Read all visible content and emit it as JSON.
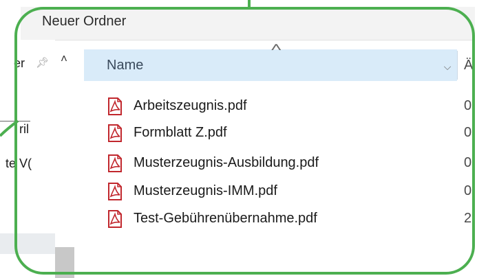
{
  "window": {
    "address": "Neuer Ordner"
  },
  "nav_pane": {
    "items": [
      {
        "label": "er"
      },
      {
        "label": "ril"
      },
      {
        "label": "te V("
      }
    ]
  },
  "columns": {
    "name": "Name",
    "next_partial": "Ä"
  },
  "files": [
    {
      "name": "Arbeitszeugnis.pdf",
      "date_partial": "0"
    },
    {
      "name": "Formblatt Z.pdf",
      "date_partial": "0"
    },
    {
      "name": "Musterzeugnis-Ausbildung.pdf",
      "date_partial": "0"
    },
    {
      "name": "Musterzeugnis-IMM.pdf",
      "date_partial": "0"
    },
    {
      "name": "Test-Gebührenübernahme.pdf",
      "date_partial": "2"
    }
  ],
  "colors": {
    "frame": "#4caf50",
    "header_bg": "#d9ebf9",
    "pdf_red": "#c1272d"
  }
}
